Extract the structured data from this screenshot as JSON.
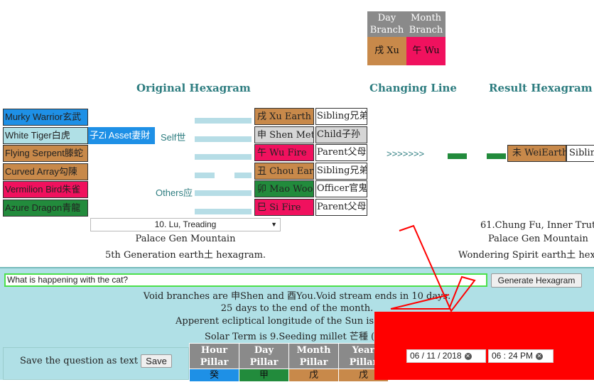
{
  "branch_table": {
    "day_label": "Day Branch",
    "month_label": "Month Branch",
    "day_value": "戌 Xu",
    "month_value": "午 Wu"
  },
  "headings": {
    "original": "Original Hexagram",
    "changing": "Changing Line",
    "result": "Result Hexagram"
  },
  "six_spirits": [
    {
      "label": "Murky Warrior玄武",
      "color": "#1e90e6"
    },
    {
      "label": "White Tiger白虎",
      "color": "#b0e0e6"
    },
    {
      "label": "Flying Serpent滕蛇",
      "color": "#c8894a"
    },
    {
      "label": "Curved Array勾陳",
      "color": "#c8894a"
    },
    {
      "label": "Vermilion Bird朱雀",
      "color": "#f0115e"
    },
    {
      "label": "Azure Dragon青龍",
      "color": "#228b3c"
    }
  ],
  "hidden_spirit": "子Zi Asset妻財",
  "self_label": "Self世",
  "others_label": "Others应",
  "line_types": [
    "yang",
    "yang",
    "yang",
    "yin",
    "yang",
    "yang"
  ],
  "branches": [
    {
      "label": "戌 Xu Earth",
      "color": "#c8894a"
    },
    {
      "label": "申 Shen Metal",
      "color": "#d6d6d6"
    },
    {
      "label": "午 Wu Fire",
      "color": "#f0115e"
    },
    {
      "label": "丑 Chou Earth",
      "color": "#c8894a"
    },
    {
      "label": "卯 Mao Wood",
      "color": "#228b3c"
    },
    {
      "label": "巳 Si Fire",
      "color": "#f0115e"
    }
  ],
  "relations": [
    {
      "label": "Sibling兄弟",
      "highlight": false
    },
    {
      "label": "Child子孙",
      "highlight": true
    },
    {
      "label": "Parent父母",
      "highlight": false
    },
    {
      "label": "Sibling兄弟",
      "highlight": false
    },
    {
      "label": "Officer官鬼",
      "highlight": false
    },
    {
      "label": "Parent父母",
      "highlight": false
    }
  ],
  "changing_arrows": ">>>>>>>",
  "result_line": {
    "branch": "未 WeiEarth",
    "relation": "Siblin"
  },
  "original_select": "10. Lu, Treading",
  "original_palace": "Palace Gen Mountain",
  "original_generation": "5th Generation earth土 hexagram.",
  "result_name": "61.Chung Fu, Inner Truth",
  "result_palace": "Palace Gen Mountain",
  "result_generation": "Wondering Spirit earth土 hexag",
  "question_value": "What is happening with the cat?",
  "generate_button": "Generate Hexagram",
  "info_lines": [
    "Void branches are 申Shen and 酉You.Void stream ends in 10 days.",
    "25 days to the end of the month.",
    "Apperent ecliptical longitude of the Sun is 80.70",
    "Solar Term is 9.Seeding millet 芒種 (芒和"
  ],
  "save_text": "Save the question as text file.",
  "save_button": "Save",
  "pillars": [
    {
      "label": "Hour Pillar",
      "value": "癸",
      "color": "#1e90e6"
    },
    {
      "label": "Day Pillar",
      "value": "甲",
      "color": "#228b3c"
    },
    {
      "label": "Month Pillar",
      "value": "戊",
      "color": "#c8894a"
    },
    {
      "label": "Year Pillar",
      "value": "戊",
      "color": "#c8894a"
    }
  ],
  "date_value": "06 / 11 / 2018",
  "time_value": "06 : 24   PM",
  "colors": {
    "heading": "#2e7d80",
    "panel": "#b0e0e6",
    "red_annotation": "#ff0000"
  }
}
